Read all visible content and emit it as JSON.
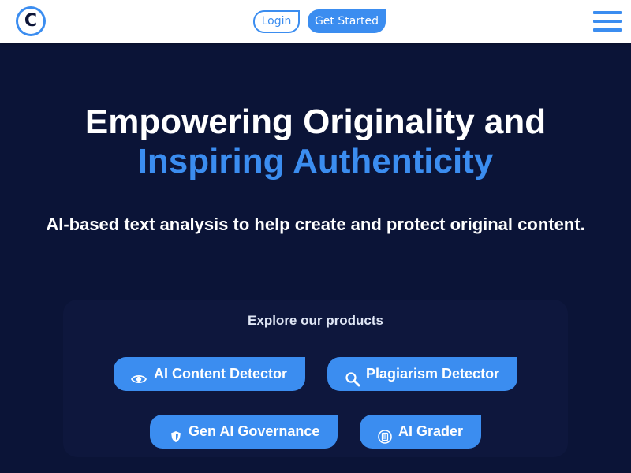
{
  "header": {
    "logo_letter": "C",
    "login_label": "Login",
    "get_started_label": "Get Started"
  },
  "hero": {
    "title_line1": "Empowering Originality and",
    "title_line2": "Inspiring Authenticity",
    "subtitle": "AI-based text analysis to help create and protect original content."
  },
  "products": {
    "heading": "Explore our products",
    "items": [
      {
        "label": "AI Content Detector",
        "icon": "eye-icon"
      },
      {
        "label": "Plagiarism Detector",
        "icon": "magnifier-icon"
      },
      {
        "label": "Gen AI Governance",
        "icon": "shield-icon"
      },
      {
        "label": "AI Grader",
        "icon": "document-icon"
      }
    ]
  },
  "colors": {
    "background": "#0b1437",
    "accent": "#3b8df0",
    "header_bg": "#ffffff",
    "text": "#ffffff"
  }
}
